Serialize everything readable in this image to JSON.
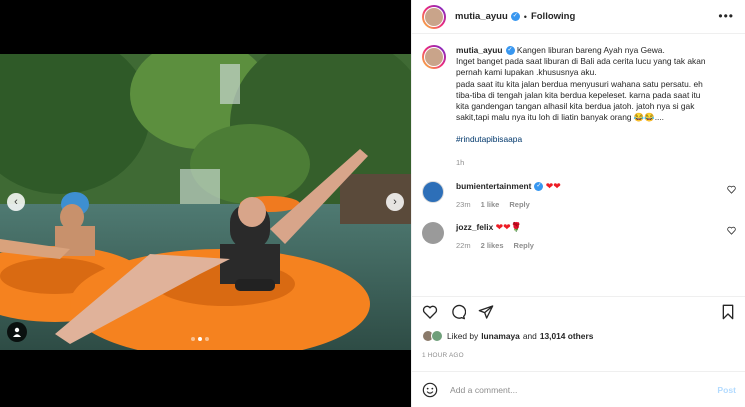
{
  "post": {
    "username": "mutia_ayuu",
    "follow_status": "Following",
    "separator": "•",
    "verified_mark": "✓",
    "more_icon": "•••",
    "caption_line1": "Kangen liburan bareng Ayah nya Gewa.",
    "caption_line2": "Inget banget pada saat liburan di Bali ada cerita lucu yang tak akan",
    "caption_line3": "pernah kami lupakan .khususnya aku.",
    "caption_line4": "pada saat itu kita jalan berdua menyusuri wahana satu persatu. eh",
    "caption_line5": "tiba-tiba di tengah jalan kita berdua kepeleset. karna pada saat itu",
    "caption_line6": "kita gandengan tangan alhasil kita berdua jatoh. jatoh nya si gak",
    "caption_line7": "sakit,tapi malu nya itu loh di liatin banyak orang 😂😂....",
    "hashtag": "#rindutapibisaapa",
    "caption_time": "1h"
  },
  "comments": [
    {
      "username": "bumientertainment",
      "text": "❤❤",
      "time": "23m",
      "likes": "1 like",
      "reply": "Reply",
      "avatar_color": "#2d6fb8"
    },
    {
      "username": "jozz_felix",
      "text": "❤❤🌹",
      "time": "22m",
      "likes": "2 likes",
      "reply": "Reply",
      "avatar_color": "#9a9a9a"
    }
  ],
  "likes": {
    "prefix": "Liked by",
    "user": "lunamaya",
    "middle": "and",
    "count": "13,014 others"
  },
  "timestamp": "1 HOUR AGO",
  "add_comment": {
    "placeholder": "Add a comment...",
    "post_label": "Post"
  },
  "carousel": {
    "left_arrow": "‹",
    "right_arrow": "›",
    "current_slide": 2,
    "total_slides": 3
  },
  "colors": {
    "link": "#00376b",
    "verified": "#3897f0",
    "post_disabled": "#b3dbff",
    "heart": "#ed1c24"
  }
}
